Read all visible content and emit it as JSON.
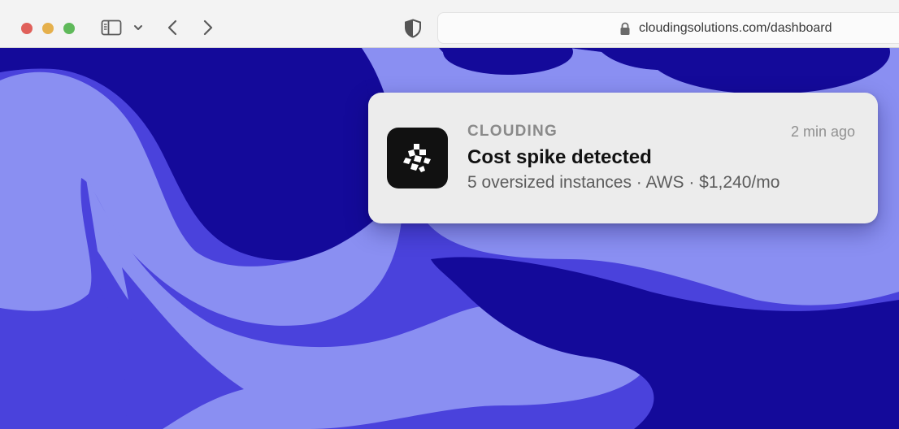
{
  "browser": {
    "url": "cloudingsolutions.com/dashboard",
    "icons": [
      "sidebar-icon",
      "chevron-down-icon",
      "chevron-left-icon",
      "chevron-right-icon",
      "shield-icon",
      "lock-icon"
    ]
  },
  "notification": {
    "app_name": "CLOUDING",
    "time": "2 min ago",
    "title": "Cost spike detected",
    "body": "5 oversized instances · AWS · $1,240/mo",
    "icon": "clouding-logo-icon"
  },
  "colors": {
    "deep_blue": "#140a9a",
    "mid_blue": "#4a42dc",
    "light_blue": "#8a8ff2",
    "toolbar_bg": "#f3f3f3",
    "notification_bg": "#ececec"
  }
}
